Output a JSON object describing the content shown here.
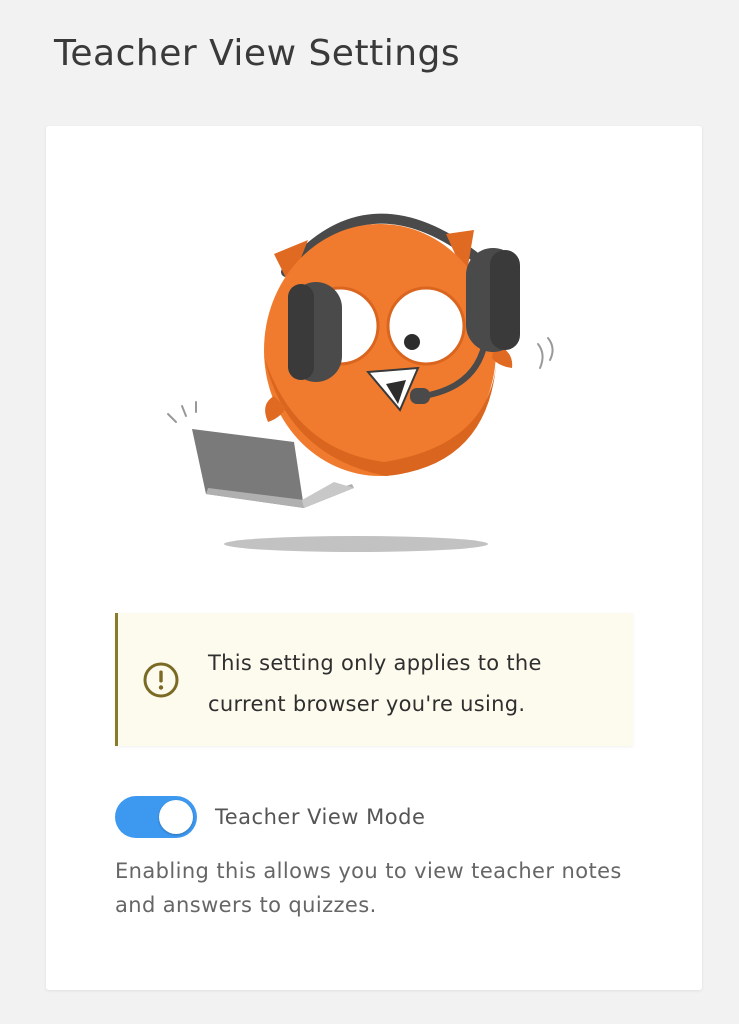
{
  "page": {
    "title": "Teacher View Settings"
  },
  "illustration": {
    "icon": "owl-with-headset-and-laptop"
  },
  "notice": {
    "icon": "exclamation-circle-icon",
    "text": "This setting only applies to the current browser you're using."
  },
  "toggle": {
    "label": "Teacher View Mode",
    "enabled": true,
    "description": "Enabling this allows you to view teacher notes and answers to quizzes."
  },
  "colors": {
    "page_background": "#f2f2f2",
    "card_background": "#ffffff",
    "owl_orange": "#f07b2e",
    "notice_background": "#fdfbee",
    "notice_accent": "#8a7a2c",
    "toggle_on": "#3d98f0"
  }
}
